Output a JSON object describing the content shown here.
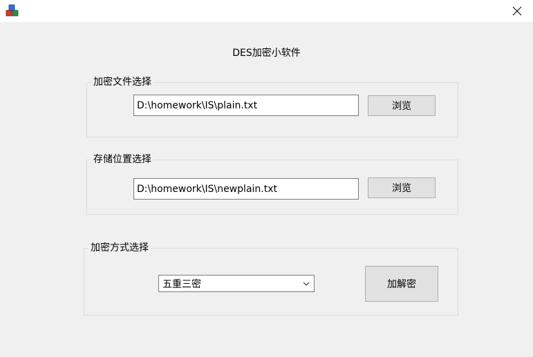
{
  "window": {
    "heading": "DES加密小软件",
    "close_glyph": "✕",
    "icon": "app-cube-icon"
  },
  "file_group": {
    "label": "加密文件选择",
    "path_value": "D:\\homework\\IS\\plain.txt",
    "browse_label": "浏览"
  },
  "save_group": {
    "label": "存储位置选择",
    "path_value": "D:\\homework\\IS\\newplain.txt",
    "browse_label": "浏览"
  },
  "method_group": {
    "label": "加密方式选择",
    "selected_method": "五重三密",
    "action_label": "加解密"
  }
}
